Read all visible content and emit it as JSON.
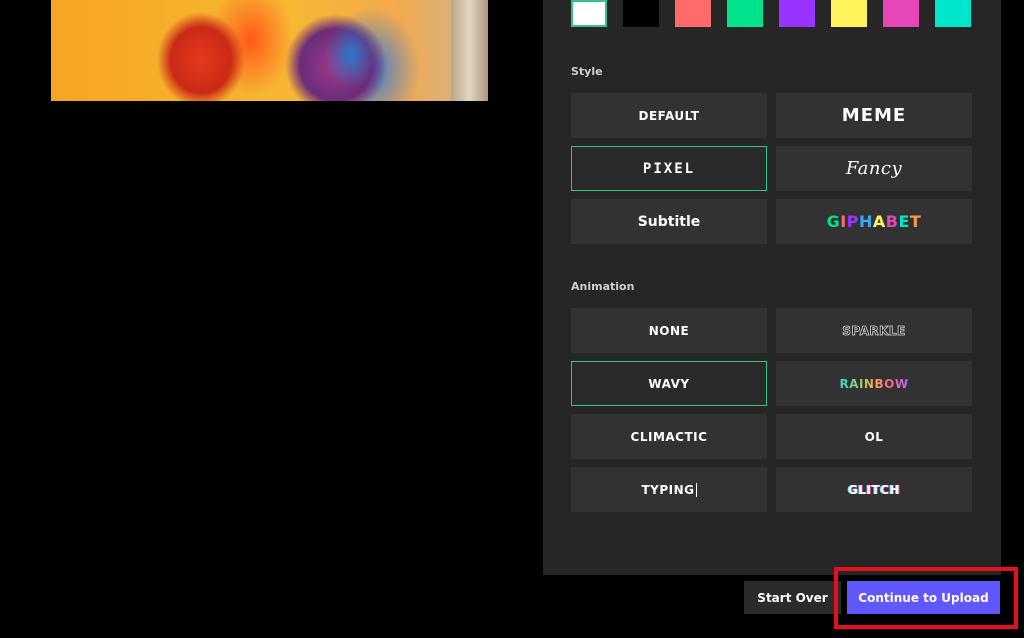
{
  "colors": {
    "panel_bg": "#262626",
    "selected_border": "#2fc58a",
    "continue_button": "#6157ff",
    "highlight": "#e5101d"
  },
  "swatches": [
    "#ffffff",
    "#000000",
    "#ff6b6b",
    "#00e38c",
    "#9933ff",
    "#fff35c",
    "#e646b6",
    "#00e6cc"
  ],
  "style_section": {
    "label": "Style",
    "options": [
      {
        "label": "DEFAULT"
      },
      {
        "label": "MEME"
      },
      {
        "label": "PIXEL",
        "selected": true
      },
      {
        "label": "Fancy"
      },
      {
        "label": "Subtitle"
      },
      {
        "label": "GIPHABET"
      }
    ]
  },
  "animation_section": {
    "label": "Animation",
    "options": [
      {
        "label": "NONE"
      },
      {
        "label": "SPARKLE"
      },
      {
        "label": "WAVY",
        "selected": true
      },
      {
        "label": "RAINBOW"
      },
      {
        "label": "CLIMACTIC"
      },
      {
        "label": "OL"
      },
      {
        "label": "TYPING"
      },
      {
        "label": "GLITCH"
      }
    ]
  },
  "buttons": {
    "start_over": "Start Over",
    "continue_upload": "Continue to Upload"
  }
}
